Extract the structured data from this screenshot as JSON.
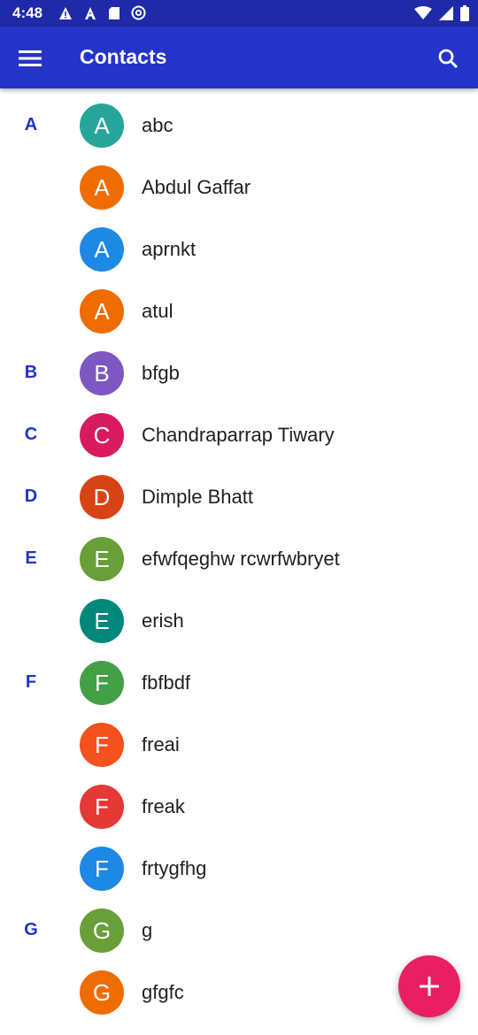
{
  "status_bar": {
    "time": "4:48",
    "icons_left": [
      "warning-icon",
      "a-icon",
      "sd-card-icon",
      "at-icon"
    ],
    "icons_right": [
      "wifi-icon",
      "signal-icon",
      "battery-icon"
    ]
  },
  "app_bar": {
    "title": "Contacts",
    "menu_icon": "hamburger-menu-icon",
    "search_icon": "search-icon",
    "color": "#2434c9"
  },
  "contacts": [
    {
      "section": "A",
      "initial": "A",
      "name": "abc",
      "color": "#26a69a"
    },
    {
      "section": "",
      "initial": "A",
      "name": "Abdul Gaffar",
      "color": "#ef6c00"
    },
    {
      "section": "",
      "initial": "A",
      "name": "aprnkt",
      "color": "#1e88e5"
    },
    {
      "section": "",
      "initial": "A",
      "name": "atul",
      "color": "#ef6c00"
    },
    {
      "section": "B",
      "initial": "B",
      "name": "bfgb",
      "color": "#7e57c2"
    },
    {
      "section": "C",
      "initial": "C",
      "name": "Chandraparrap Tiwary",
      "color": "#d81b60"
    },
    {
      "section": "D",
      "initial": "D",
      "name": "Dimple Bhatt",
      "color": "#d84315"
    },
    {
      "section": "E",
      "initial": "E",
      "name": "efwfqeghw rcwrfwbryet",
      "color": "#689f38"
    },
    {
      "section": "",
      "initial": "E",
      "name": "erish",
      "color": "#00897b"
    },
    {
      "section": "F",
      "initial": "F",
      "name": "fbfbdf",
      "color": "#43a047"
    },
    {
      "section": "",
      "initial": "F",
      "name": "freai",
      "color": "#f4511e"
    },
    {
      "section": "",
      "initial": "F",
      "name": "freak",
      "color": "#e53935"
    },
    {
      "section": "",
      "initial": "F",
      "name": "frtygfhg",
      "color": "#1e88e5"
    },
    {
      "section": "G",
      "initial": "G",
      "name": "g",
      "color": "#689f38"
    },
    {
      "section": "",
      "initial": "G",
      "name": "gfgfc",
      "color": "#ef6c00"
    }
  ],
  "fab": {
    "icon": "plus-icon",
    "color": "#e91e63"
  }
}
